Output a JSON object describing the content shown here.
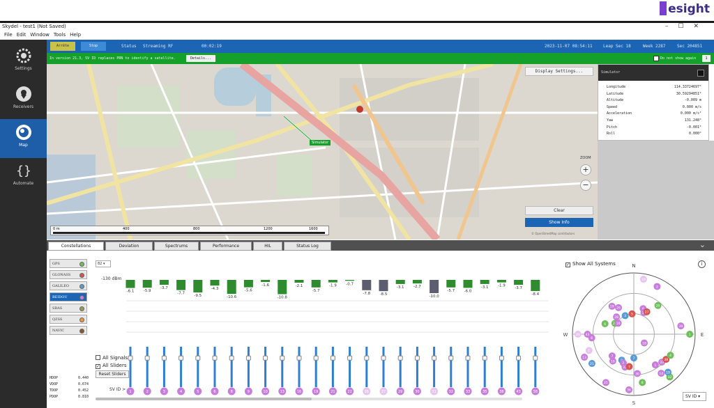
{
  "brand": {
    "name": "esight"
  },
  "window": {
    "title": "Skydel - test1 (Not Saved)",
    "controls": [
      "–",
      "☐",
      "✕"
    ]
  },
  "menu": [
    "File",
    "Edit",
    "Window",
    "Tools",
    "Help"
  ],
  "sidebar": [
    {
      "label": "Settings",
      "icon": "gear-icon"
    },
    {
      "label": "Receivers",
      "icon": "location-pin-icon"
    },
    {
      "label": "Map",
      "icon": "satellite-icon",
      "active": true
    },
    {
      "label": "Automate",
      "icon": "braces-icon"
    }
  ],
  "header": {
    "btn1": "Arrête",
    "btn2": "Stop",
    "status_label": "Status",
    "status_value": "Streaming RF",
    "elapsed": "00:02:19",
    "datetime": "2023-11-07  08:54:11",
    "leap": "Leap Sec  18",
    "week": "Week  2287",
    "sec": "Sec  204851"
  },
  "notification": {
    "message": "In version 21.3, SV ID replaces PRN to identify a satellite.",
    "details": "Details...",
    "dont_show": "Do not show again",
    "count": "1"
  },
  "map": {
    "display_settings": "Display Settings...",
    "simulator_label": "Simulator",
    "zoom_label": "ZOOM",
    "zoom_in": "+",
    "zoom_out": "−",
    "clear": "Clear",
    "show_info": "Show Info",
    "scale_ticks": [
      "0 m",
      "400",
      "800",
      "1200",
      "1600"
    ],
    "copyright": "© OpenStreetMap contributors"
  },
  "sim_panel": {
    "title": "Simulator",
    "rows": [
      {
        "k": "Longitude",
        "v": "114.33724697°"
      },
      {
        "k": "Latitude",
        "v": "30.59294851°"
      },
      {
        "k": "Altitude",
        "v": "-0.009 m"
      },
      {
        "k": "Speed",
        "v": "0.000 m/s"
      },
      {
        "k": "Acceleration",
        "v": "0.000 m/s²"
      },
      {
        "k": "Yaw",
        "v": "131.248°"
      },
      {
        "k": "Pitch",
        "v": "-0.001°"
      },
      {
        "k": "Roll",
        "v": "0.000°"
      }
    ]
  },
  "tabs": [
    "Constellations",
    "Deviation",
    "Spectrums",
    "Performance",
    "HIL",
    "Status Log"
  ],
  "constellations": [
    {
      "label": "GPS",
      "color": "#6fbf5a"
    },
    {
      "label": "GLONASS",
      "color": "#d9534f"
    },
    {
      "label": "GALILEO",
      "color": "#5b9bd5"
    },
    {
      "label": "BEIDOU",
      "color": "#c77ddb",
      "active": true
    },
    {
      "label": "SBAS",
      "color": "#9b9b4f"
    },
    {
      "label": "QZSS",
      "color": "#e89a3c"
    },
    {
      "label": "NAVIC",
      "color": "#8b5a2b"
    }
  ],
  "dop": [
    {
      "k": "HDOP",
      "v": "0.440"
    },
    {
      "k": "VDOP",
      "v": "0.674"
    },
    {
      "k": "TDOP",
      "v": "0.452"
    },
    {
      "k": "PDOP",
      "v": "0.810"
    }
  ],
  "controls": {
    "select_value": "82",
    "cn0_label": "-130 dBm",
    "all_signals": "All Signals",
    "all_sliders": "All Sliders",
    "reset_sliders": "Reset Sliders",
    "sv_id_label": "SV ID >",
    "show_all_systems": "Show All Systems",
    "info": "i",
    "sv_select": "SV ID"
  },
  "chart_data": {
    "type": "bar",
    "title": "",
    "ylabel": "",
    "categories": [
      "1",
      "2",
      "3",
      "4",
      "5",
      "6",
      "8",
      "9",
      "10",
      "13",
      "16",
      "19",
      "21",
      "22",
      "26",
      "27",
      "29",
      "30",
      "31",
      "32",
      "33",
      "35",
      "38",
      "43",
      "58"
    ],
    "values": [
      -6.1,
      -5.9,
      -3.7,
      -7.7,
      -9.5,
      -4.3,
      -10.6,
      -5.6,
      -1.6,
      -10.8,
      -2.1,
      -5.7,
      -1.9,
      -0.7,
      -7.8,
      -8.5,
      -3.1,
      -2.7,
      -10.0,
      -5.7,
      -6.0,
      -3.1,
      -1.9,
      -3.7,
      -8.4
    ],
    "bar_colors": [
      "#2e8b2e",
      "#2e8b2e",
      "#2e8b2e",
      "#2e8b2e",
      "#2e8b2e",
      "#2e8b2e",
      "#2e8b2e",
      "#2e8b2e",
      "#2e8b2e",
      "#2e8b2e",
      "#2e8b2e",
      "#2e8b2e",
      "#2e8b2e",
      "#2e8b2e",
      "#5d5d70",
      "#5d5d70",
      "#2e8b2e",
      "#2e8b2e",
      "#5d5d70",
      "#2e8b2e",
      "#2e8b2e",
      "#2e8b2e",
      "#2e8b2e",
      "#2e8b2e",
      "#2e8b2e"
    ],
    "ylim": [
      -12,
      0
    ]
  },
  "sliders": {
    "levels": [
      0.72,
      0.72,
      0.72,
      0.72,
      0.72,
      0.72,
      0.72,
      0.72,
      0.72,
      0.72,
      0.72,
      0.72,
      0.72,
      0.72,
      0.72,
      0.72,
      0.72,
      0.72,
      0.72,
      0.72,
      0.72,
      0.72,
      0.72,
      0.72,
      0.72
    ],
    "badge_color": "#c77ddb",
    "faded_badge_color": "#e6c6ef"
  },
  "skyplot": {
    "cardinals": {
      "n": "N",
      "e": "E",
      "s": "S",
      "w": "W"
    },
    "satellites": [
      {
        "id": "19",
        "az": 10,
        "el": 8,
        "color": "#e6c6ef"
      },
      {
        "id": "2",
        "az": 26,
        "el": 12,
        "color": "#c77ddb"
      },
      {
        "id": "6",
        "az": 290,
        "el": 45,
        "color": "#6fbf5a"
      },
      {
        "id": "29",
        "az": 322,
        "el": 38,
        "color": "#c77ddb"
      },
      {
        "id": "26",
        "az": 330,
        "el": 45,
        "color": "#c77ddb"
      },
      {
        "id": "21",
        "az": 300,
        "el": 58,
        "color": "#6fbf5a"
      },
      {
        "id": "10",
        "az": 305,
        "el": 62,
        "color": "#c77ddb"
      },
      {
        "id": "28",
        "az": 315,
        "el": 54,
        "color": "#c77ddb"
      },
      {
        "id": "3",
        "az": 335,
        "el": 60,
        "color": "#5b9bd5"
      },
      {
        "id": "5",
        "az": 355,
        "el": 60,
        "color": "#d9534f"
      },
      {
        "id": "6",
        "az": 20,
        "el": 50,
        "color": "#c77ddb"
      },
      {
        "id": "13",
        "az": 25,
        "el": 55,
        "color": "#c77ddb"
      },
      {
        "id": "27",
        "az": 30,
        "el": 52,
        "color": "#d9534f"
      },
      {
        "id": "20",
        "az": 40,
        "el": 35,
        "color": "#6fbf5a"
      },
      {
        "id": "39",
        "az": 80,
        "el": 20,
        "color": "#c77ddb"
      },
      {
        "id": "8",
        "az": 265,
        "el": 28,
        "color": "#c77ddb"
      },
      {
        "id": "43",
        "az": 270,
        "el": 22,
        "color": "#c77ddb"
      },
      {
        "id": "1",
        "az": 90,
        "el": 8,
        "color": "#6fbf5a"
      },
      {
        "id": "1",
        "az": 250,
        "el": 20,
        "color": "#e6c6ef"
      },
      {
        "id": "7",
        "az": 180,
        "el": 55,
        "color": "#5b9bd5"
      },
      {
        "id": "18",
        "az": 130,
        "el": 70,
        "color": "#c77ddb"
      },
      {
        "id": "7",
        "az": 225,
        "el": 45,
        "color": "#c77ddb"
      },
      {
        "id": "16",
        "az": 218,
        "el": 40,
        "color": "#c77ddb"
      },
      {
        "id": "9",
        "az": 205,
        "el": 48,
        "color": "#5b9bd5"
      },
      {
        "id": "2",
        "az": 200,
        "el": 45,
        "color": "#c77ddb"
      },
      {
        "id": "22",
        "az": 195,
        "el": 40,
        "color": "#c77ddb"
      },
      {
        "id": "7",
        "az": 188,
        "el": 42,
        "color": "#d9534f"
      },
      {
        "id": "30",
        "az": 175,
        "el": 32,
        "color": "#c77ddb"
      },
      {
        "id": "1",
        "az": 145,
        "el": 35,
        "color": "#c77ddb"
      },
      {
        "id": "33",
        "az": 135,
        "el": 32,
        "color": "#c77ddb"
      },
      {
        "id": "38",
        "az": 128,
        "el": 30,
        "color": "#d9534f"
      },
      {
        "id": "4",
        "az": 120,
        "el": 28,
        "color": "#6fbf5a"
      },
      {
        "id": "14",
        "az": 145,
        "el": 20,
        "color": "#c77ddb"
      },
      {
        "id": "32",
        "az": 140,
        "el": 8,
        "color": "#6fbf5a"
      },
      {
        "id": "19",
        "az": 138,
        "el": 15,
        "color": "#5b9bd5"
      },
      {
        "id": "8",
        "az": 170,
        "el": 18,
        "color": "#6fbf5a"
      },
      {
        "id": "36",
        "az": 185,
        "el": 8,
        "color": "#c77ddb"
      },
      {
        "id": "25",
        "az": 210,
        "el": 8,
        "color": "#c77ddb"
      },
      {
        "id": "21",
        "az": 235,
        "el": 15,
        "color": "#5b9bd5"
      },
      {
        "id": "13",
        "az": 245,
        "el": 10,
        "color": "#c77ddb"
      },
      {
        "id": "20",
        "az": 270,
        "el": 8,
        "color": "#e6c6ef"
      }
    ]
  }
}
